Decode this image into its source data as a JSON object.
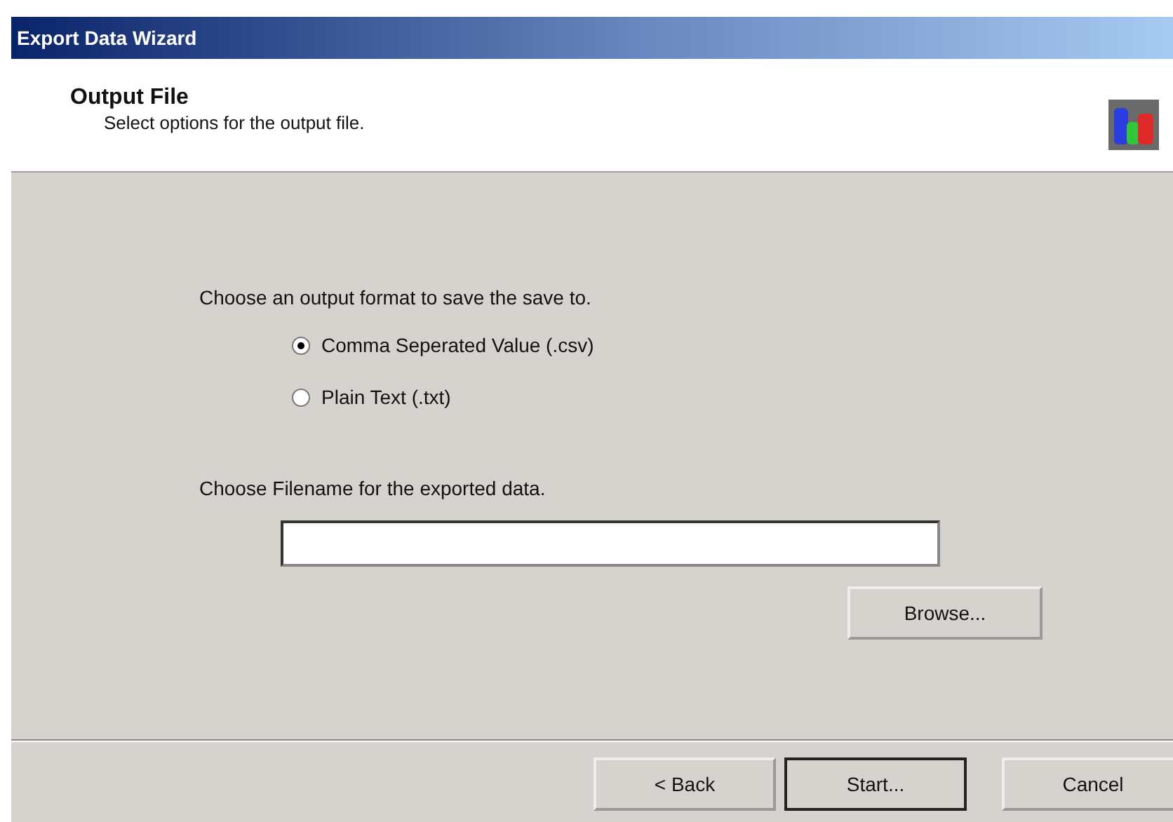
{
  "window": {
    "title": "Export Data Wizard"
  },
  "header": {
    "title": "Output File",
    "subtitle": "Select options for the output file."
  },
  "format": {
    "prompt": "Choose an output format to save the save to.",
    "options": [
      {
        "label": "Comma Seperated Value (.csv)",
        "selected": true
      },
      {
        "label": "Plain Text (.txt)",
        "selected": false
      }
    ]
  },
  "filename": {
    "prompt": "Choose Filename for the exported data.",
    "browse": "Browse..."
  },
  "buttons": [
    {
      "label": "< Back",
      "default": false
    },
    {
      "label": "Start...",
      "default": true
    },
    {
      "label": "Cancel",
      "default": false
    }
  ]
}
